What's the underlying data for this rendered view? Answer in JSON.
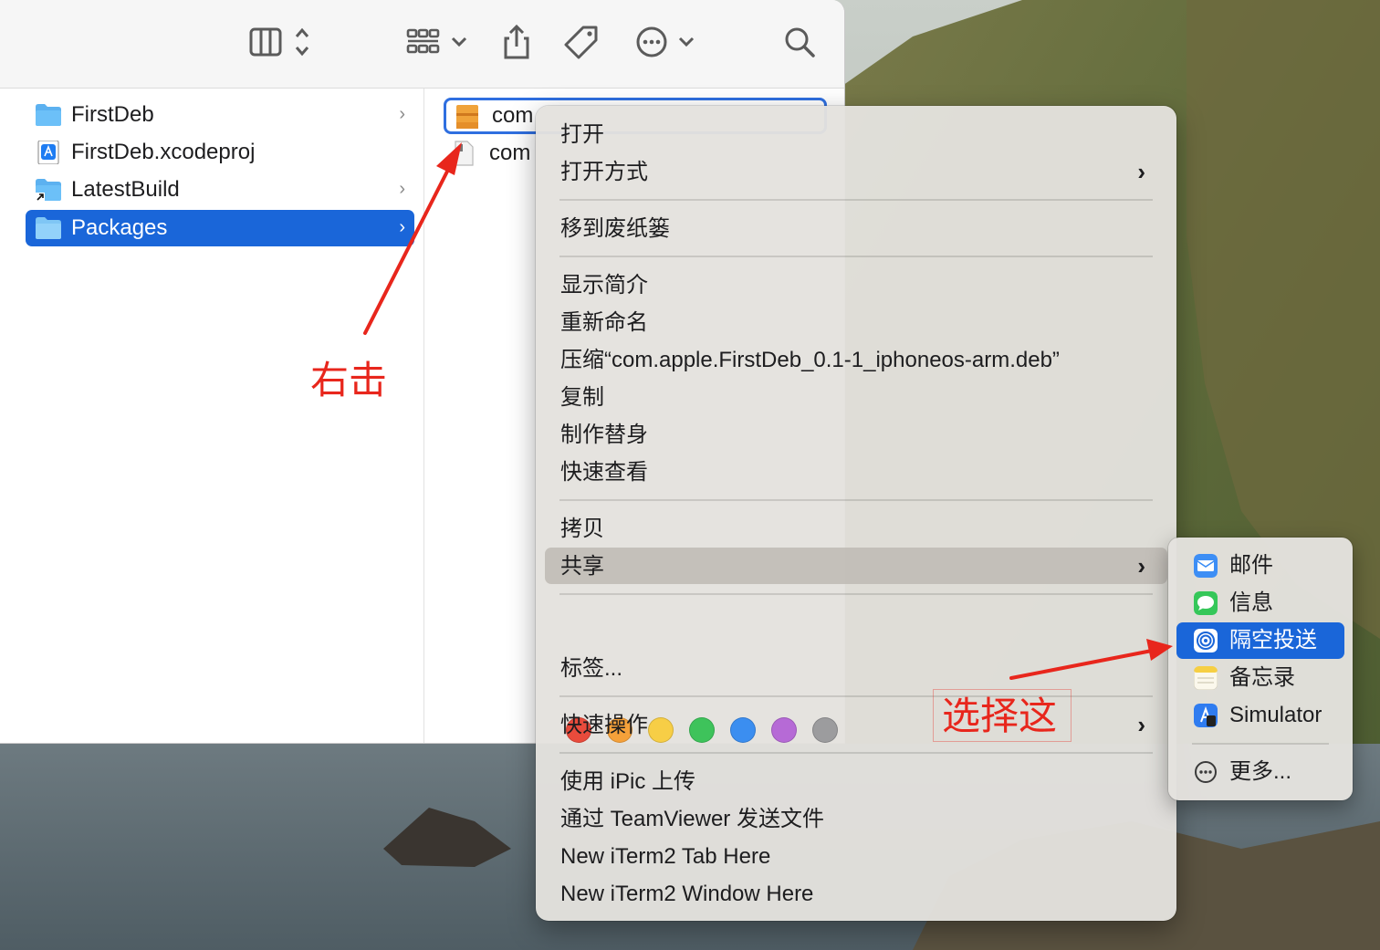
{
  "finder": {
    "toolbar_icons": [
      "sidebar-toggle-icon",
      "view-grid-icon",
      "share-icon",
      "tag-icon",
      "more-icon",
      "search-icon"
    ],
    "column1": [
      {
        "label": "FirstDeb",
        "icon": "folder-icon",
        "has_children": true,
        "selected": false
      },
      {
        "label": "FirstDeb.xcodeproj",
        "icon": "xcodeproj-icon",
        "has_children": false,
        "selected": false
      },
      {
        "label": "LatestBuild",
        "icon": "alias-folder-icon",
        "has_children": true,
        "selected": false
      },
      {
        "label": "Packages",
        "icon": "folder-icon",
        "has_children": true,
        "selected": true
      }
    ],
    "column2": [
      {
        "label": "com",
        "icon": "deb-package-icon",
        "renaming": true
      },
      {
        "label": "com",
        "icon": "document-icon",
        "renaming": false
      }
    ],
    "chevron": "›"
  },
  "context_menu": {
    "arrow": "›",
    "items": [
      {
        "label": "打开"
      },
      {
        "label": "打开方式",
        "submenu": true
      },
      {
        "label": "移到废纸篓"
      },
      {
        "label": "显示简介"
      },
      {
        "label": "重新命名"
      },
      {
        "label": "压缩“com.apple.FirstDeb_0.1-1_iphoneos-arm.deb”"
      },
      {
        "label": "复制"
      },
      {
        "label": "制作替身"
      },
      {
        "label": "快速查看"
      },
      {
        "label": "拷贝"
      },
      {
        "label": "共享",
        "submenu": true,
        "highlighted": true
      },
      {
        "label": "标签..."
      },
      {
        "label": "快速操作",
        "submenu": true
      },
      {
        "label": "使用 iPic 上传"
      },
      {
        "label": "通过 TeamViewer 发送文件"
      },
      {
        "label": "New iTerm2 Tab Here"
      },
      {
        "label": "New iTerm2 Window Here"
      }
    ],
    "tag_colors": [
      "#e94b3c",
      "#f5a13a",
      "#f7ce46",
      "#3ec35b",
      "#3b8ef0",
      "#b66ad6",
      "#9c9c9e"
    ]
  },
  "share_submenu": {
    "items": [
      {
        "label": "邮件",
        "icon": "mail-icon"
      },
      {
        "label": "信息",
        "icon": "messages-icon"
      },
      {
        "label": "隔空投送",
        "icon": "airdrop-icon",
        "selected": true
      },
      {
        "label": "备忘录",
        "icon": "notes-icon"
      },
      {
        "label": "Simulator",
        "icon": "simulator-icon"
      },
      {
        "label": "更多...",
        "icon": "more-circle-icon"
      }
    ]
  },
  "annotations": {
    "right_click": "右击",
    "select_this": "选择这",
    "color": "#e8261c"
  },
  "colors": {
    "selection_blue": "#1a66d9",
    "menu_bg": "#e4e2de"
  }
}
